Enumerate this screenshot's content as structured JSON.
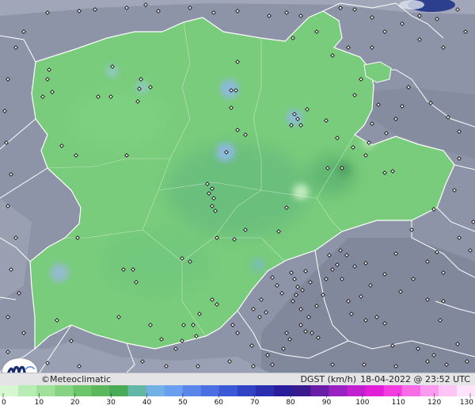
{
  "brand": {
    "name": "©Meteoclimatic",
    "logo_icon": "meteoclimatic-m-logo"
  },
  "product": {
    "label": "DGST (km/h)",
    "timestamp": "18-04-2022 @ 23:52 UTC"
  },
  "colors": {
    "background_terrain": "#8e94a8",
    "region_fill": "#79cc7b",
    "border": "#ffffff",
    "station_marker": "#111111"
  },
  "scale": {
    "unit": "km/h",
    "tick_values": [
      0,
      10,
      20,
      30,
      40,
      50,
      60,
      70,
      80,
      90,
      100,
      110,
      120,
      130
    ],
    "colors": [
      "#d6f7d2",
      "#b8ecb4",
      "#9fe09a",
      "#86d383",
      "#6ec66b",
      "#5cb85a",
      "#4aab57",
      "#62b8a4",
      "#72b0e6",
      "#6a9ff0",
      "#5a86ea",
      "#4a6fe2",
      "#3b58d6",
      "#3043c4",
      "#2a2faf",
      "#2a1d9b",
      "#3a1b8d",
      "#6a1fa9",
      "#9a22c1",
      "#c020cf",
      "#e11fd8",
      "#f23ee0",
      "#f86de6",
      "#fb9aee",
      "#fdc4f5",
      "#ffe3fa"
    ]
  }
}
